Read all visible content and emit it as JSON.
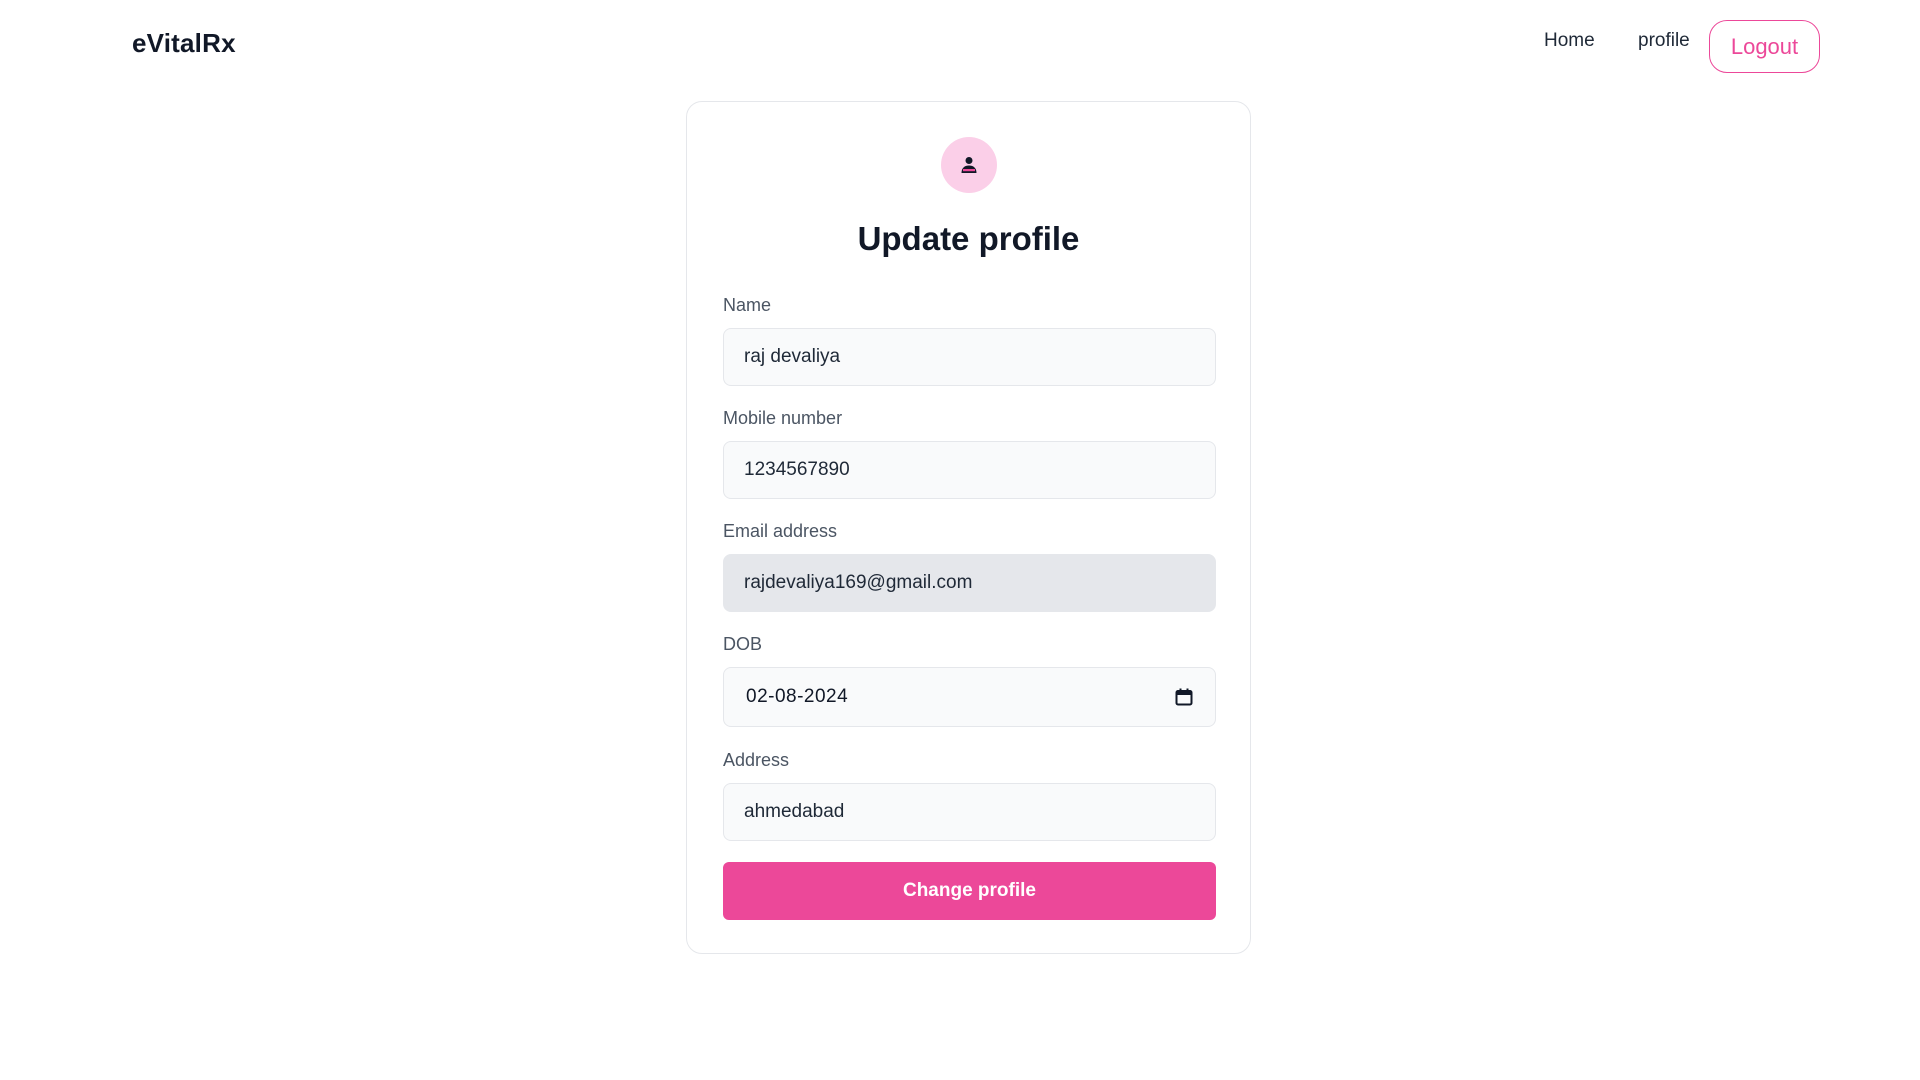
{
  "navbar": {
    "brand": "eVitalRx",
    "links": {
      "home": "Home",
      "profile": "profile"
    },
    "logout_label": "Logout"
  },
  "form": {
    "avatar_icon": "user-icon",
    "title": "Update profile",
    "fields": {
      "name": {
        "label": "Name",
        "value": "raj devaliya"
      },
      "mobile": {
        "label": "Mobile number",
        "value": "1234567890"
      },
      "email": {
        "label": "Email address",
        "value": "rajdevaliya169@gmail.com"
      },
      "dob": {
        "label": "DOB",
        "value": "02-08-2024"
      },
      "address": {
        "label": "Address",
        "value": "ahmedabad"
      }
    },
    "submit_label": "Change profile"
  },
  "colors": {
    "accent": "#ec4899",
    "avatar_bg": "#fbcfe8",
    "input_bg": "#f9fafb",
    "disabled_bg": "#e5e7eb"
  }
}
